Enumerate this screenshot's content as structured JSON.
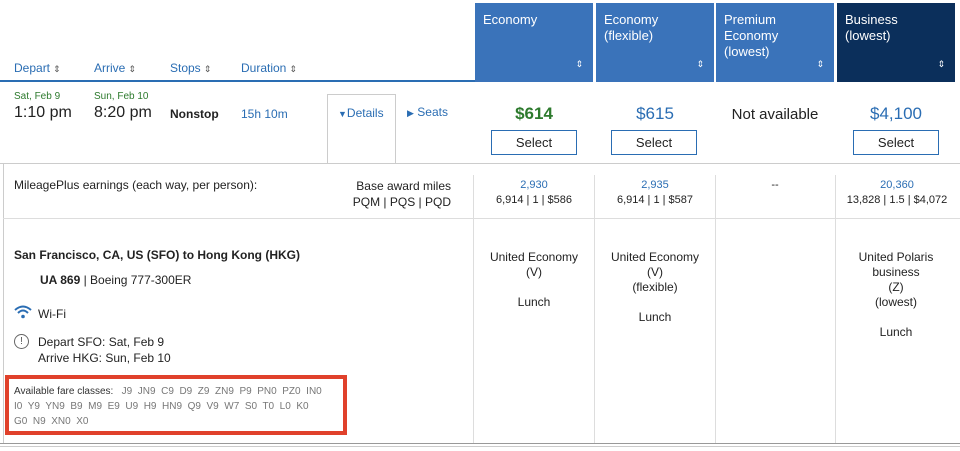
{
  "sort_headers": {
    "depart": "Depart",
    "arrive": "Arrive",
    "stops": "Stops",
    "duration": "Duration",
    "arrow": "⇕"
  },
  "fare_columns": [
    {
      "label": "Economy"
    },
    {
      "label": "Economy (flexible)"
    },
    {
      "label": "Premium Economy (lowest)"
    },
    {
      "label": "Business (lowest)"
    }
  ],
  "flight": {
    "depart_date": "Sat, Feb 9",
    "depart_time": "1:10 pm",
    "arrive_date": "Sun, Feb 10",
    "arrive_time": "8:20 pm",
    "stops": "Nonstop",
    "duration": "15h 10m",
    "details_label": "Details",
    "seats_label": "Seats"
  },
  "prices": {
    "economy": "$614",
    "economy_flexible": "$615",
    "premium_economy": "Not available",
    "business": "$4,100",
    "select_label": "Select"
  },
  "earnings": {
    "label": "MileagePlus earnings (each way, per person):",
    "header_line1": "Base award miles",
    "header_line2": "PQM | PQS | PQD",
    "economy_miles": "2,930",
    "economy_detail": "6,914 | 1 | $586",
    "economy_flex_miles": "2,935",
    "economy_flex_detail": "6,914 | 1 | $587",
    "premium_miles": "--",
    "business_miles": "20,360",
    "business_detail": "13,828 | 1.5 | $4,072"
  },
  "segment": {
    "route": "San Francisco, CA, US (SFO) to Hong Kong (HKG)",
    "flight_number": "UA 869",
    "aircraft": "| Boeing 777-300ER",
    "wifi": "Wi-Fi",
    "depart_line": "Depart SFO: Sat, Feb 9",
    "arrive_line": "Arrive HKG: Sun, Feb 10"
  },
  "cabins": {
    "economy": [
      "United Economy",
      "(V)",
      "",
      "Lunch"
    ],
    "economy_flexible": [
      "United Economy",
      "(V)",
      "(flexible)",
      "",
      "Lunch"
    ],
    "business": [
      "United Polaris",
      "business",
      "(Z)",
      "(lowest)",
      "",
      "Lunch"
    ]
  },
  "fare_classes": {
    "label": "Available fare classes:",
    "line1": "J9  JN9  C9  D9  Z9  ZN9  P9  PN0  PZ0  IN0",
    "line2": "I0  Y9  YN9  B9  M9  E9  U9  H9  HN9  Q9  V9  W7  S0  T0  L0  K0",
    "line3": "G0  N9  XN0  X0"
  },
  "colors": {
    "header_blue": "#3a73ba",
    "header_navy": "#0b2f5b",
    "link_blue": "#2a6db3",
    "price_green": "#2d7a2d",
    "highlight_red": "#e0412b"
  }
}
